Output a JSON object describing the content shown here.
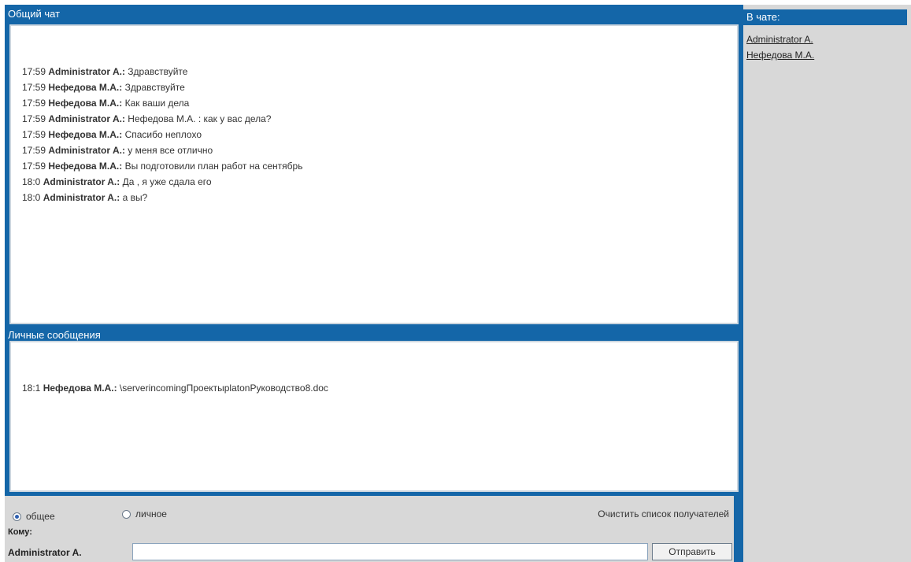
{
  "public_chat": {
    "title": "Общий чат",
    "messages": [
      {
        "time": "17:59",
        "author": "Administrator A.:",
        "text": "Здравствуйте"
      },
      {
        "time": "17:59",
        "author": "Нефедова М.А.:",
        "text": "Здравствуйте"
      },
      {
        "time": "17:59",
        "author": "Нефедова М.А.:",
        "text": "Как ваши дела"
      },
      {
        "time": "17:59",
        "author": "Administrator A.:",
        "text": "Нефедова М.А. : как у вас дела?"
      },
      {
        "time": "17:59",
        "author": "Нефедова М.А.:",
        "text": "Спасибо неплохо"
      },
      {
        "time": "17:59",
        "author": "Administrator A.:",
        "text": "у меня все отлично"
      },
      {
        "time": "17:59",
        "author": "Нефедова М.А.:",
        "text": "Вы подготовили план работ на сентябрь"
      },
      {
        "time": "18:0",
        "author": "Administrator A.:",
        "text": "Да , я уже сдала его"
      },
      {
        "time": "18:0",
        "author": "Administrator A.:",
        "text": "а вы?"
      }
    ]
  },
  "private_chat": {
    "title": "Личные сообщения",
    "messages": [
      {
        "time": "18:1",
        "author": "Нефедова М.А.:",
        "text": "\\serverincomingПроектыplatonРуководство8.doc"
      }
    ]
  },
  "composer": {
    "radio_general": "общее",
    "radio_private": "личное",
    "selected": "general",
    "clear_recipients": "Очистить список получателей",
    "to_label": "Кому:",
    "recipient": "Administrator A.",
    "message_value": "",
    "send_label": "Отправить"
  },
  "online": {
    "title": "В чате:",
    "users": [
      "Administrator A.",
      "Нефедова М.А."
    ]
  },
  "colors": {
    "header_blue": "#1466a8",
    "panel_gray": "#d8d8d8"
  }
}
